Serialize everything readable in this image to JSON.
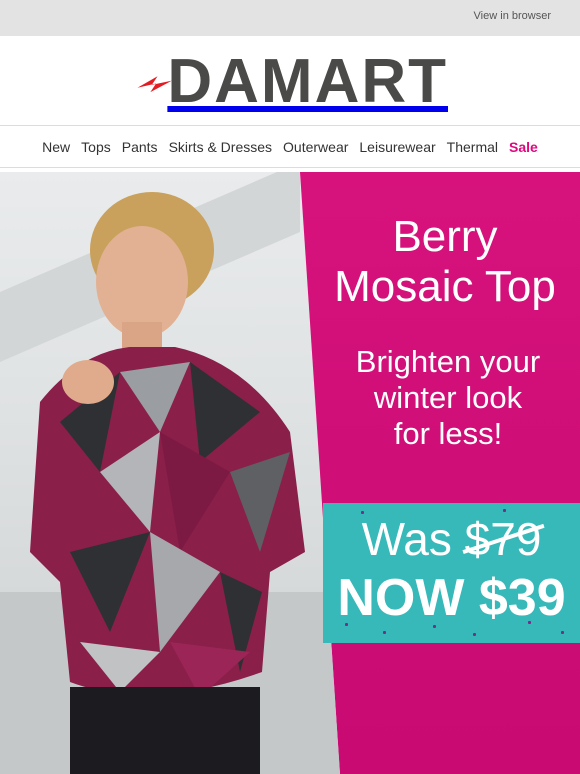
{
  "preheader": {
    "view_in_browser": "View in browser"
  },
  "brand": {
    "name": "DAMART",
    "logo_color": "#4a4a48",
    "swoosh_color": "#e31b23"
  },
  "nav": {
    "items": [
      "New",
      "Tops",
      "Pants",
      "Skirts & Dresses",
      "Outerwear",
      "Leisurewear",
      "Thermal"
    ],
    "sale_label": "Sale",
    "sale_color": "#e0087f"
  },
  "hero": {
    "background_color": "#d8137e",
    "headline_line1": "Berry",
    "headline_line2": "Mosaic Top",
    "subline_line1": "Brighten your",
    "subline_line2": "winter look",
    "subline_line3": "for less!",
    "price_box_color": "#37b8b9",
    "was_label": "Was",
    "was_price": "$79",
    "now_label": "NOW $39"
  }
}
